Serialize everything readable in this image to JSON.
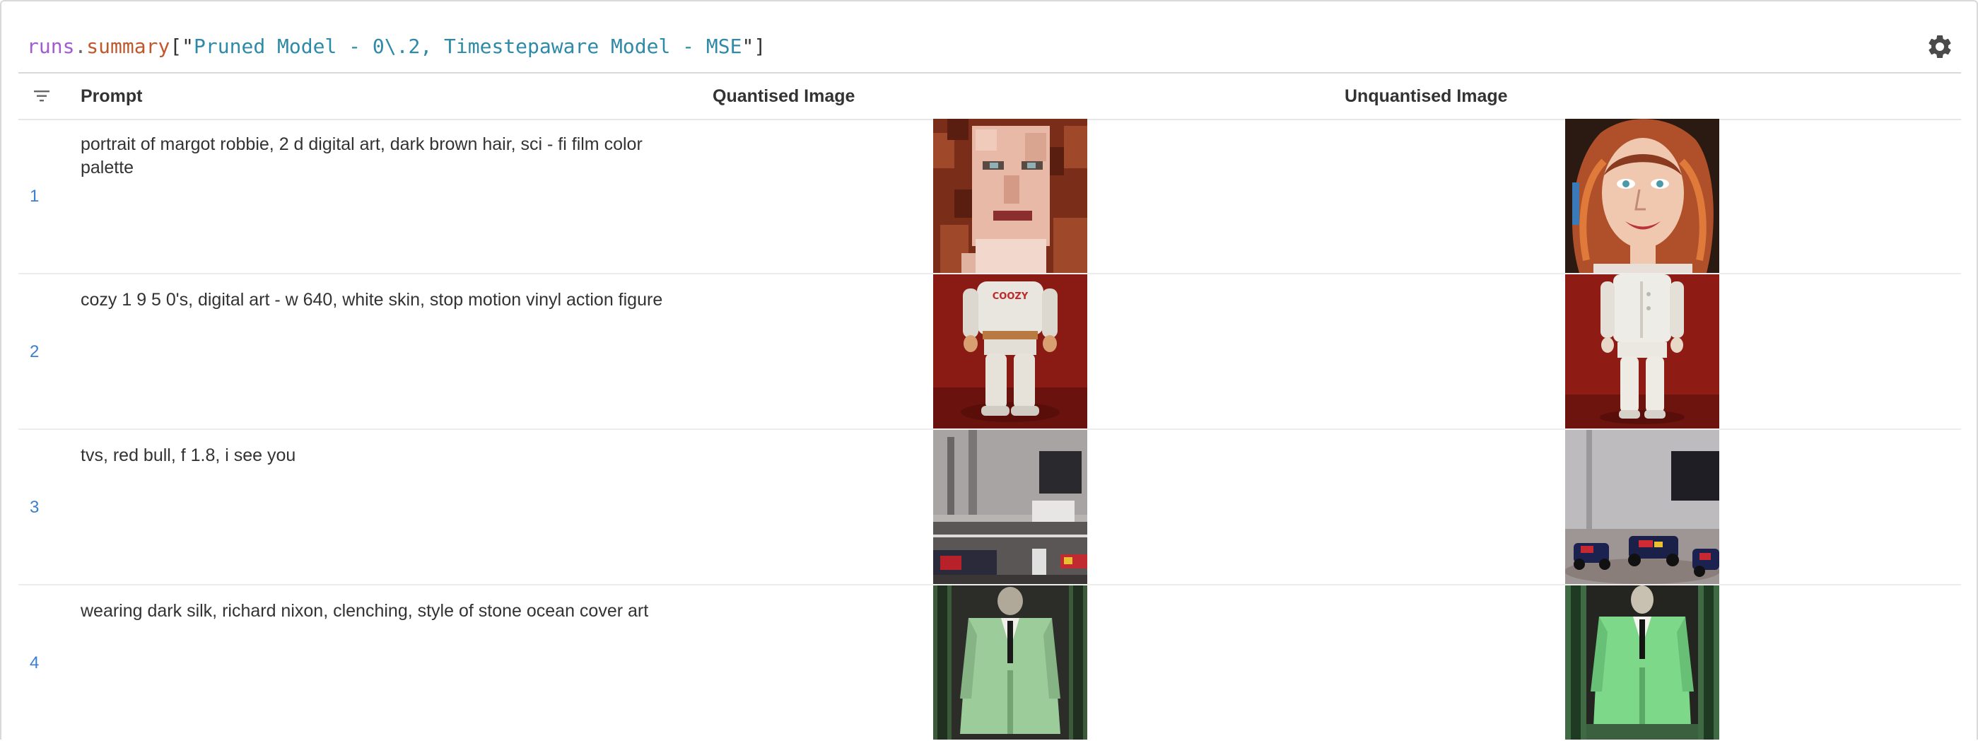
{
  "query": {
    "object": "runs",
    "dot": ".",
    "property": "summary",
    "open": "[\"",
    "key": "Pruned Model - 0\\.2, Timestepaware Model - MSE",
    "close": "\"]"
  },
  "columns": {
    "prompt": "Prompt",
    "quantised": "Quantised Image",
    "unquantised": "Unquantised Image"
  },
  "rows": [
    {
      "num": "1",
      "prompt": "portrait of margot robbie, 2 d digital art, dark brown hair, sci - fi film color palette"
    },
    {
      "num": "2",
      "prompt": "cozy 1 9 5 0's, digital art - w 640, white skin, stop motion vinyl action figure",
      "shirt_text": "COOZY"
    },
    {
      "num": "3",
      "prompt": "tvs, red bull, f 1.8, i see you"
    },
    {
      "num": "4",
      "prompt": "wearing dark silk, richard nixon, clenching, style of stone ocean cover art"
    }
  ]
}
